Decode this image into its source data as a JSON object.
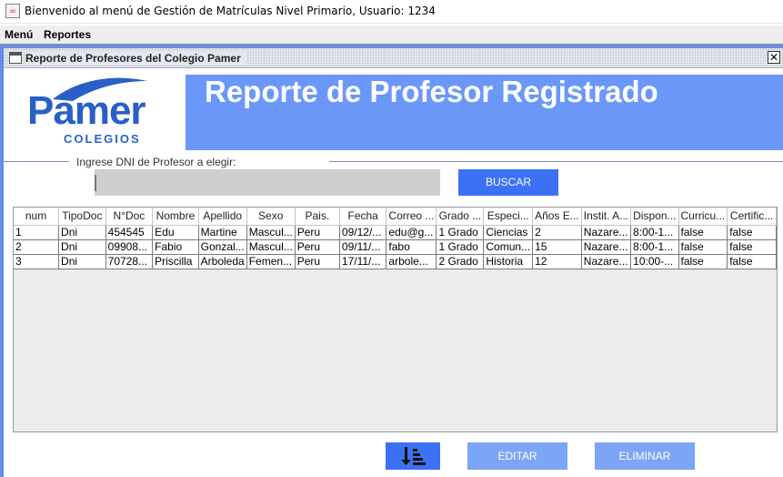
{
  "window": {
    "title": "Bienvenido al menú de Gestión de Matrículas Nivel Primario, Usuario: 1234"
  },
  "menubar": {
    "items": [
      {
        "label": "Menú"
      },
      {
        "label": "Reportes"
      }
    ]
  },
  "internal_frame": {
    "title": "Reporte de Profesores del Colegio Pamer",
    "close_glyph": "✕"
  },
  "logo": {
    "brand": "Pamer",
    "subtitle": "COLEGIOS"
  },
  "banner": {
    "heading": "Reporte de Profesor Registrado",
    "color": "#6b98f8"
  },
  "search": {
    "group_label": "Ingrese DNI de Profesor a elegir:",
    "value": "",
    "button_label": "BUSCAR"
  },
  "table": {
    "columns": [
      "num",
      "TipoDoc",
      "N°Doc",
      "Nombre",
      "Apellido",
      "Sexo",
      "Pais.",
      "Fecha",
      "Correo ...",
      "Grado ...",
      "Especi...",
      "Años E...",
      "Instit. A...",
      "Dispon...",
      "Curricu...",
      "Certific..."
    ],
    "rows": [
      [
        "1",
        "Dni",
        "454545",
        "Edu",
        "Martine",
        "Mascul...",
        "Peru",
        "09/12/...",
        "edu@g...",
        "1 Grado",
        "Ciencias",
        "2",
        "Nazare...",
        "8:00-1...",
        "false",
        "false"
      ],
      [
        "2",
        "Dni",
        "09908...",
        "Fabio",
        "Gonzal...",
        "Mascul...",
        "Peru",
        "09/11/...",
        "fabo",
        "1 Grado",
        "Comun...",
        "15",
        "Nazare...",
        "8:00-1...",
        "false",
        "false"
      ],
      [
        "3",
        "Dni",
        "70728...",
        "Priscilla",
        "Arboleda",
        "Femen...",
        "Peru",
        "17/11/...",
        "arbole...",
        "2 Grado",
        "Historia",
        "12",
        "Nazare...",
        "10:00-...",
        "false",
        "false"
      ]
    ]
  },
  "actions": {
    "sort_icon": "sort-descending-icon",
    "edit_label": "EDITAR",
    "delete_label": "ELIMINAR"
  },
  "colors": {
    "primary_button": "#3d71f5",
    "disabled_button": "#7da5f7",
    "desktop": "#6d8fd6",
    "brand_blue": "#2a5fc8"
  }
}
